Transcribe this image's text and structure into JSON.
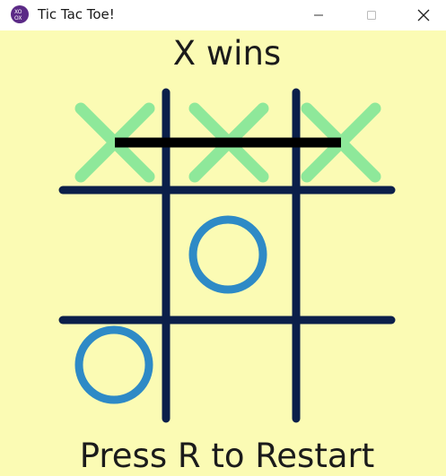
{
  "window": {
    "title": "Tic Tac Toe!",
    "icon": "xo-app-icon",
    "controls": [
      "minimize",
      "maximize",
      "close"
    ]
  },
  "game": {
    "status": "X wins",
    "restart_hint": "Press R to Restart",
    "board": [
      [
        "X",
        "X",
        "X"
      ],
      [
        "",
        "O",
        ""
      ],
      [
        "O",
        "",
        ""
      ]
    ],
    "winning_line": "row-1"
  },
  "colors": {
    "background": "#fbfbb4",
    "grid": "#0b1f4a",
    "x_mark": "#8ee89a",
    "o_mark": "#2e8ac6",
    "win_line": "#000000"
  }
}
